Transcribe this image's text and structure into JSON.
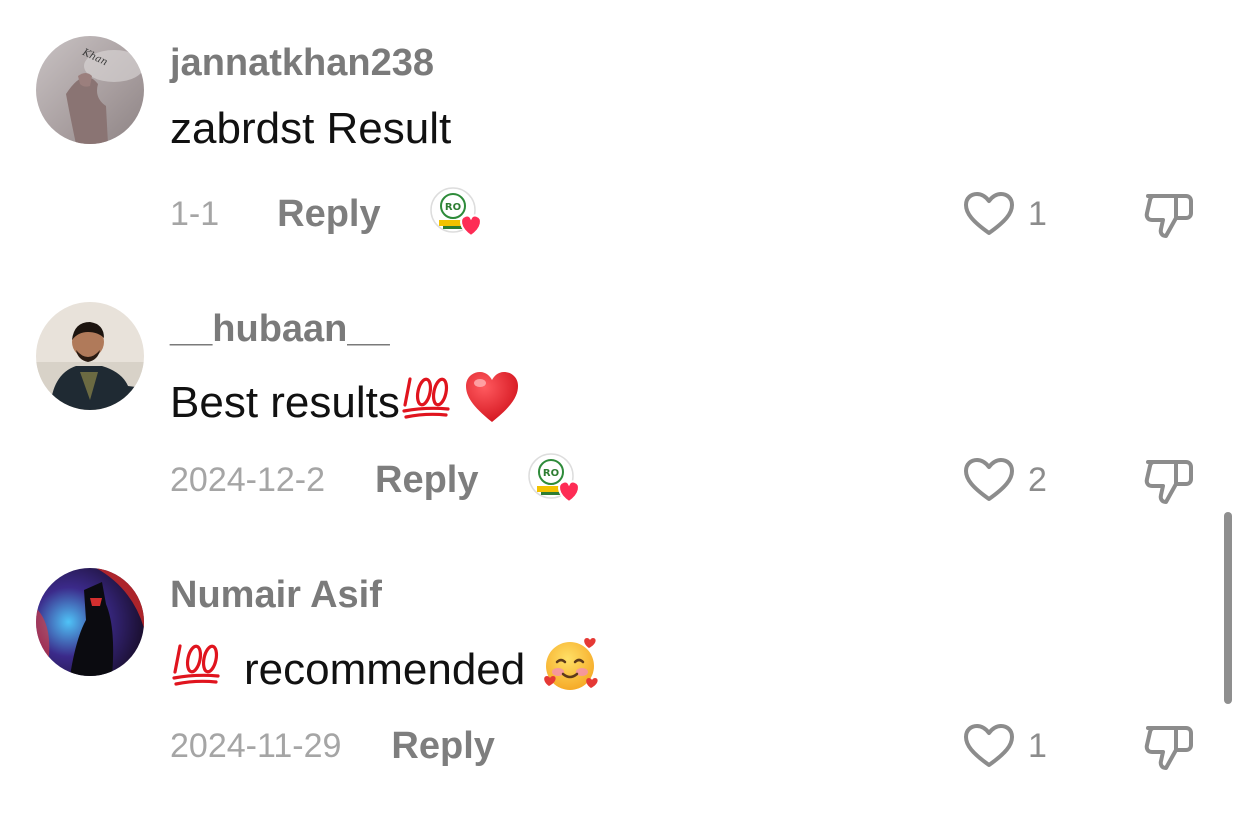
{
  "comments": [
    {
      "username": "jannatkhan238",
      "text": "zabrdst Result",
      "date": "1-1",
      "reply_label": "Reply",
      "like_count": "1",
      "avatar_text": "Khan"
    },
    {
      "username": "__hubaan__",
      "text": "Best results",
      "date": "2024-12-2",
      "reply_label": "Reply",
      "like_count": "2",
      "emoji_after": [
        "100",
        "red-heart"
      ]
    },
    {
      "username": "Numair Asif",
      "text": "recommended",
      "date": "2024-11-29",
      "reply_label": "Reply",
      "like_count": "1",
      "emoji_before": [
        "100"
      ],
      "emoji_after": [
        "smiling-face-with-hearts"
      ]
    }
  ],
  "creator_badge_text": "RO",
  "colors": {
    "username": "#7a7a7a",
    "text": "#111111",
    "meta": "#a5a5a5",
    "reply": "#7e7e7e",
    "heart_badge": "#fe2c55",
    "emoji_red": "#e0141e"
  }
}
